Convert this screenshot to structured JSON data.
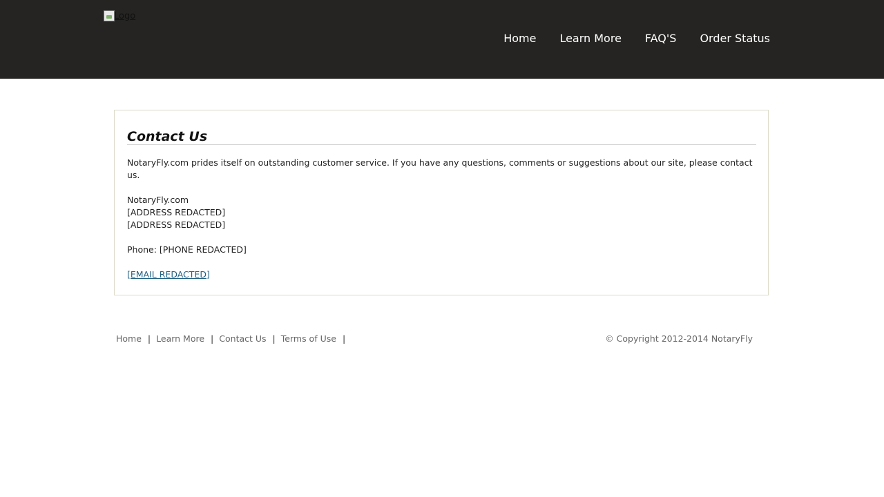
{
  "header": {
    "logo_alt": "Logo",
    "nav": [
      {
        "label": "Home"
      },
      {
        "label": "Learn More"
      },
      {
        "label": "FAQ'S"
      },
      {
        "label": "Order Status"
      }
    ]
  },
  "content": {
    "title": "Contact Us",
    "intro": "NotaryFly.com prides itself on outstanding customer service. If you have any questions, comments or suggestions about our site, please contact us.",
    "company": "NotaryFly.com",
    "address_line1": "[ADDRESS REDACTED]",
    "address_line2": "[ADDRESS REDACTED]",
    "phone": "Phone: [PHONE REDACTED]",
    "email": "[EMAIL REDACTED]"
  },
  "footer": {
    "links": [
      {
        "label": "Home"
      },
      {
        "label": "Learn More"
      },
      {
        "label": "Contact Us"
      },
      {
        "label": "Terms of Use"
      }
    ],
    "separator": "|",
    "copyright": "© Copyright 2012-2014 NotaryFly"
  }
}
